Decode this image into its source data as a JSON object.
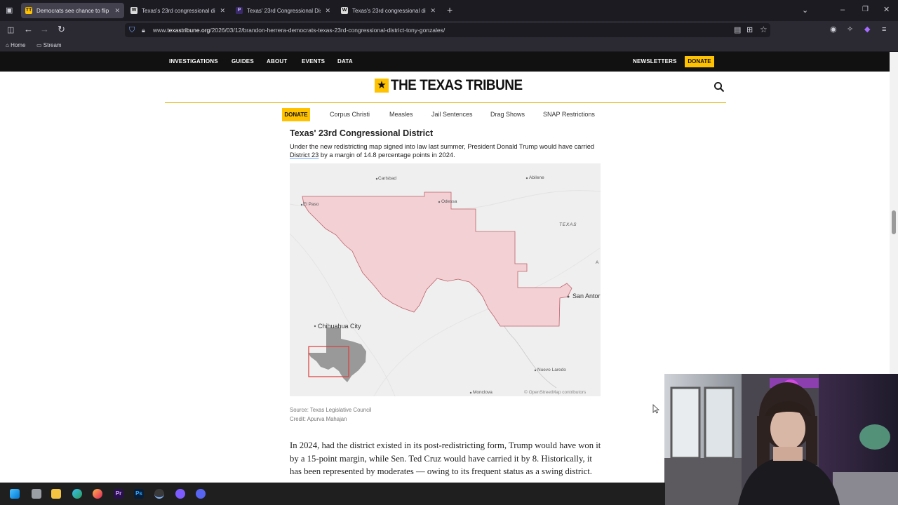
{
  "browser": {
    "tabs": [
      {
        "title": "Democrats see chance to flip 2…",
        "active": true,
        "favicon": "TT",
        "favicon_color": "#ffc200"
      },
      {
        "title": "Texas's 23rd congressional distr…",
        "active": false,
        "favicon": "W",
        "favicon_color": "#ffffff"
      },
      {
        "title": "Texas' 23rd Congressional Distr…",
        "active": false,
        "favicon": "P",
        "favicon_color": "#7a5cff"
      },
      {
        "title": "Texas's 23rd congressional distr…",
        "active": false,
        "favicon": "W",
        "favicon_color": "#ffffff"
      }
    ],
    "url_prefix": "www.",
    "url_host": "texastribune.org",
    "url_path": "/2026/03/12/brandon-herrera-democrats-texas-23rd-congressional-district-tony-gonzales/",
    "bookmarks": [
      "Home",
      "Stream"
    ]
  },
  "site": {
    "nav": [
      "INVESTIGATIONS",
      "GUIDES",
      "ABOUT",
      "EVENTS",
      "DATA"
    ],
    "newsletters": "NEWSLETTERS",
    "donate": "DONATE",
    "logo_text": "THE TEXAS TRIBUNE",
    "subnav_donate": "DONATE",
    "subnav": [
      "Corpus Christi",
      "Measles",
      "Jail Sentences",
      "Drag Shows",
      "SNAP Restrictions"
    ],
    "accent": "#ffc200"
  },
  "article": {
    "graphic_title": "Texas' 23rd Congressional District",
    "desc_before": "Under the new redistricting map signed into law last summer, President Donald Trump would have carried ",
    "desc_link": "District 23",
    "desc_after": " by a margin of 14.8 percentage points in 2024.",
    "source": "Source: Texas Legislative Council",
    "credit": "Credit: Apurva Mahajan",
    "paragraph": "In 2024, had the district existed in its post-redistricting form, Trump would have won it by a 15-point margin, while Sen. Ted Cruz would have carried it by 8. Historically, it has been represented by moderates — owing to its frequent status as a swing district."
  },
  "map": {
    "district_fill": "#f2d0d4",
    "district_stroke": "#c0616b",
    "labels": {
      "carlsbad": "Carlsbad",
      "abilene": "Abilene",
      "el_paso": "El Paso",
      "odessa": "Odessa",
      "texas": "TEXAS",
      "san_antonio": "San Antor",
      "chihuahua": "Chihuahua City",
      "nuevo_laredo": "Nuevo Laredo",
      "monclova": "Monclova",
      "attribution": "© OpenStreetMap contributors",
      "edge_a": "A"
    }
  },
  "taskbar": {
    "icons": [
      "windows-icon",
      "file-explorer-icon",
      "folder-icon",
      "edge-icon",
      "firefox-icon",
      "premiere-icon",
      "photoshop-icon",
      "obs-icon",
      "app-icon",
      "discord-icon"
    ]
  }
}
